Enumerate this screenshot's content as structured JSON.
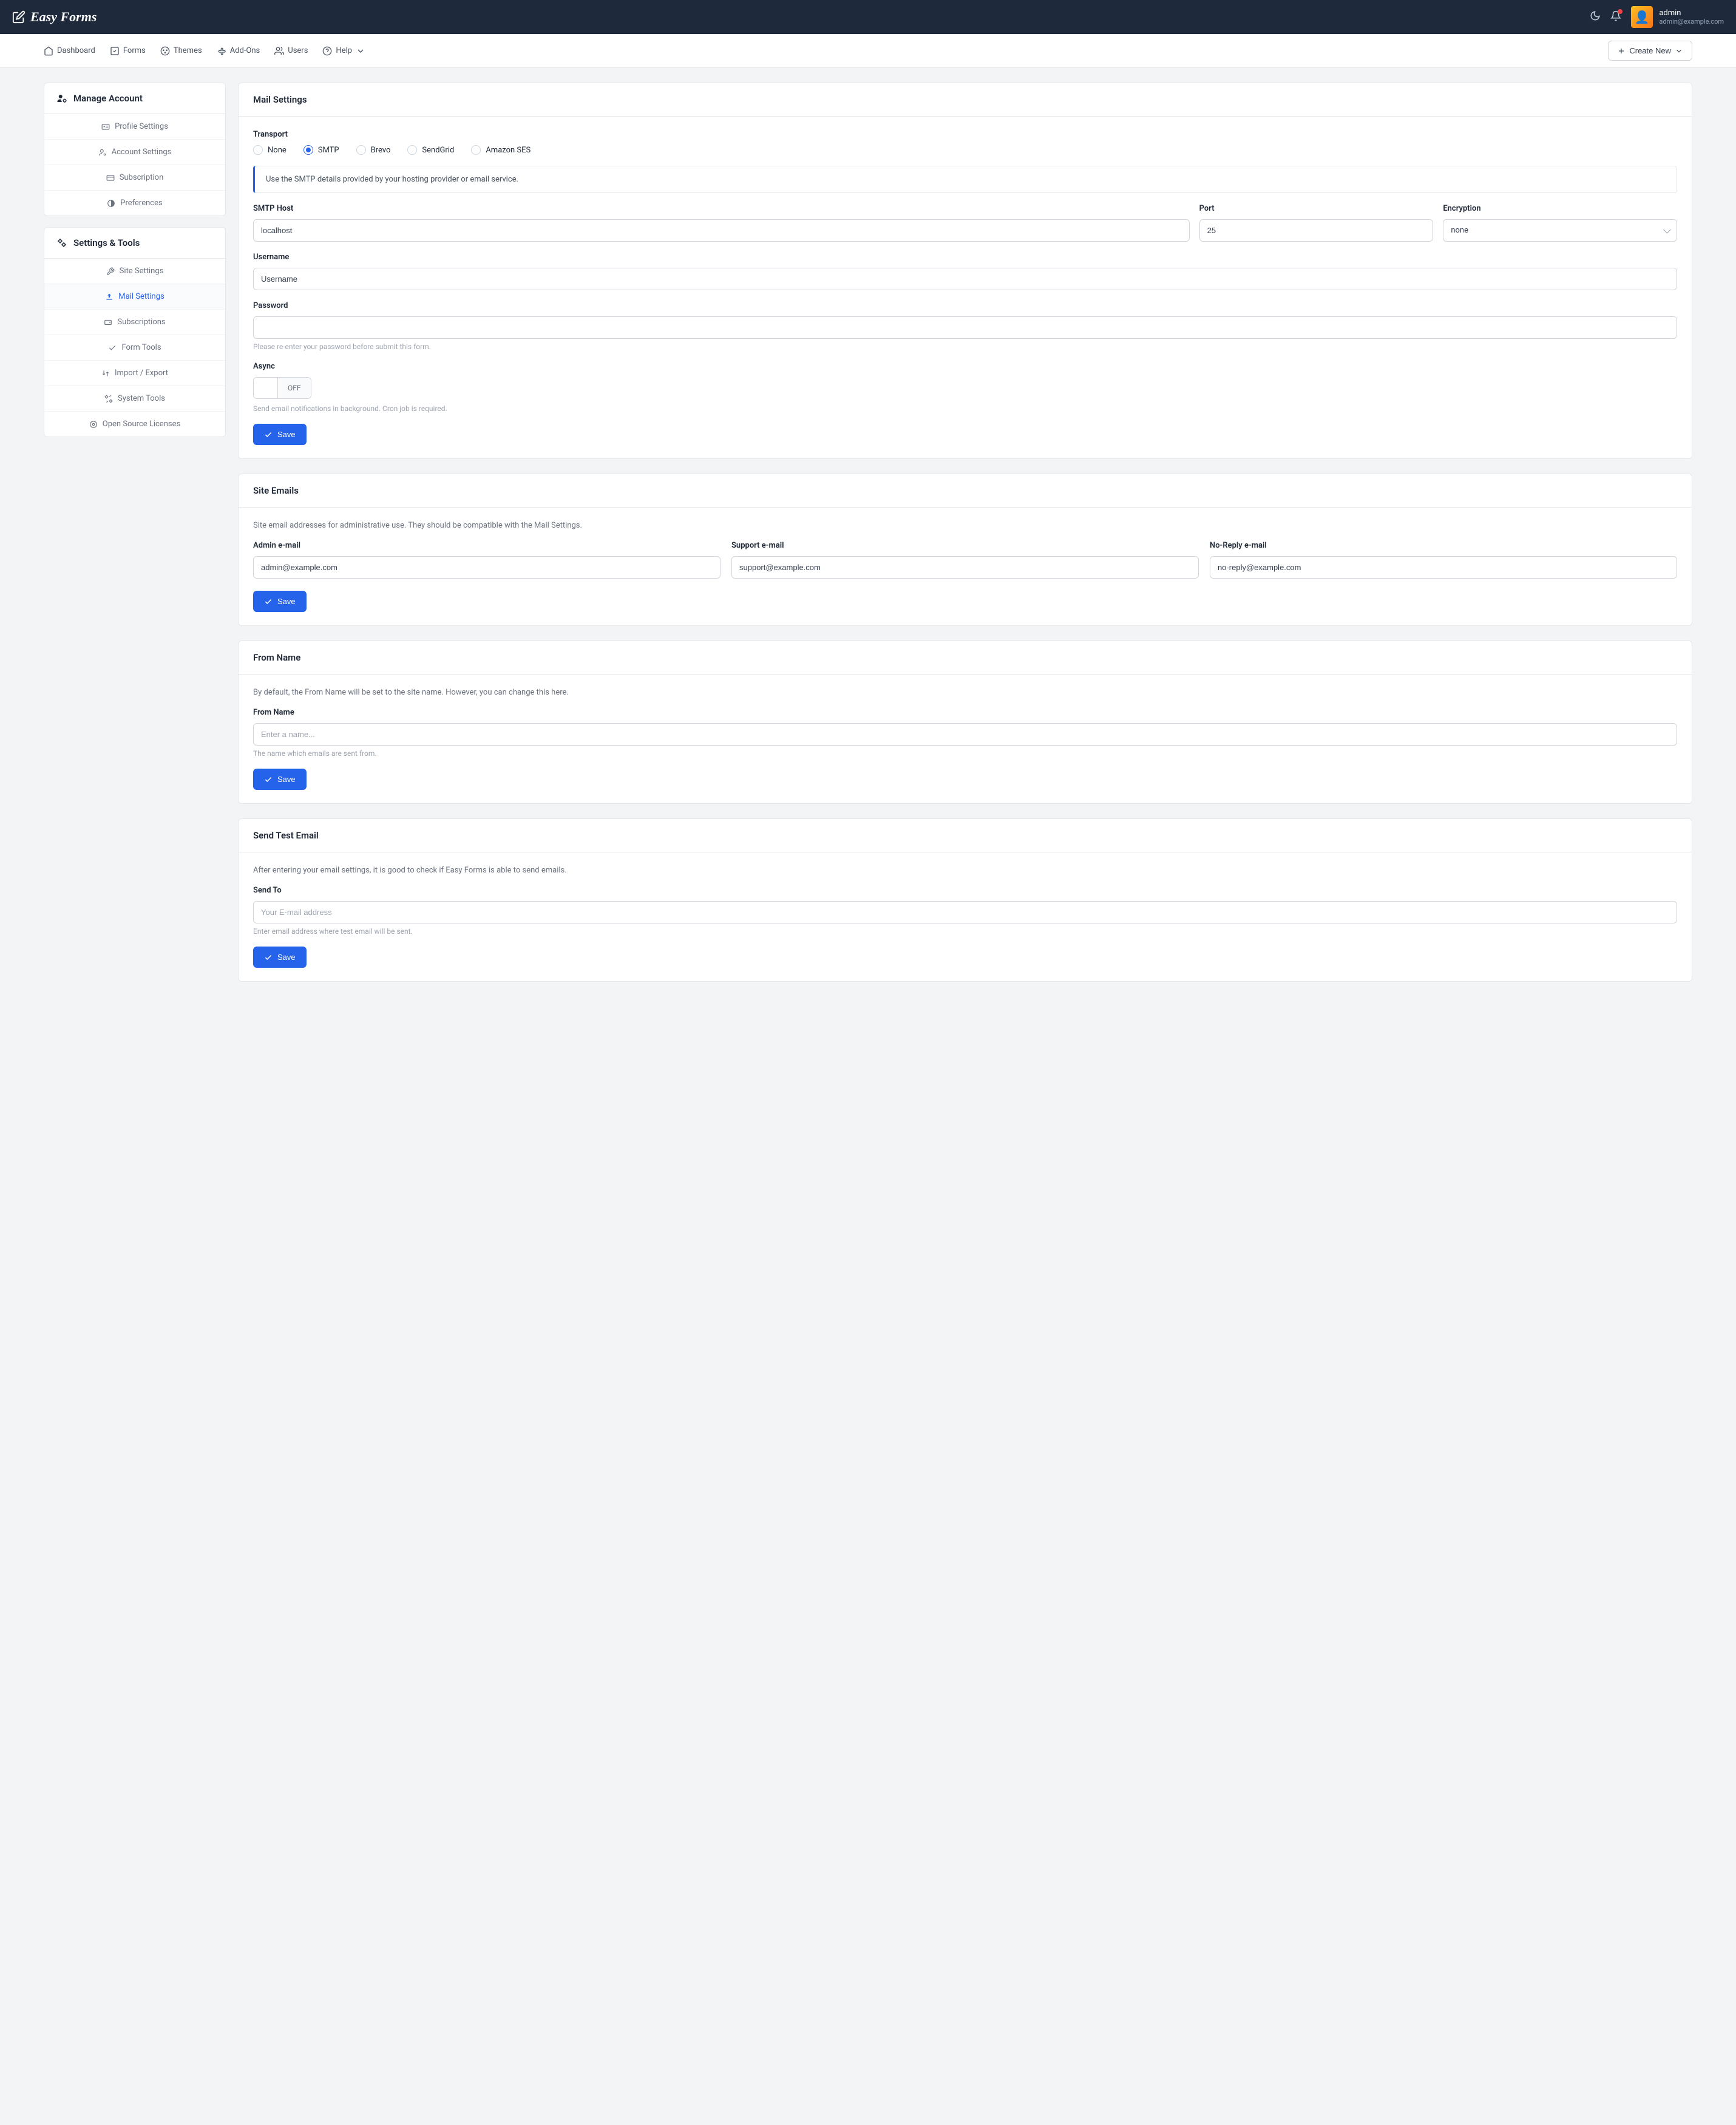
{
  "brand": "Easy Forms",
  "user": {
    "name": "admin",
    "email": "admin@example.com"
  },
  "topnav": {
    "dashboard": "Dashboard",
    "forms": "Forms",
    "themes": "Themes",
    "addons": "Add-Ons",
    "users": "Users",
    "help": "Help",
    "create": "Create New"
  },
  "sidebar": {
    "manage": {
      "title": "Manage Account",
      "profile": "Profile Settings",
      "account": "Account Settings",
      "subscription": "Subscription",
      "preferences": "Preferences"
    },
    "tools": {
      "title": "Settings & Tools",
      "site": "Site Settings",
      "mail": "Mail Settings",
      "subs": "Subscriptions",
      "ftools": "Form Tools",
      "import": "Import / Export",
      "system": "System Tools",
      "licenses": "Open Source Licenses"
    }
  },
  "mail": {
    "title": "Mail Settings",
    "transport_label": "Transport",
    "transports": {
      "none": "None",
      "smtp": "SMTP",
      "brevo": "Brevo",
      "sendgrid": "SendGrid",
      "ses": "Amazon SES"
    },
    "info": "Use the SMTP details provided by your hosting provider or email service.",
    "host_label": "SMTP Host",
    "host_value": "localhost",
    "port_label": "Port",
    "port_value": "25",
    "enc_label": "Encryption",
    "enc_value": "none",
    "user_label": "Username",
    "user_value": "Username",
    "pass_label": "Password",
    "pass_hint": "Please re-enter your password before submit this form.",
    "async_label": "Async",
    "async_value": "OFF",
    "async_hint": "Send email notifications in background. Cron job is required.",
    "save": "Save"
  },
  "emails": {
    "title": "Site Emails",
    "desc": "Site email addresses for administrative use. They should be compatible with the Mail Settings.",
    "admin_label": "Admin e-mail",
    "admin_value": "admin@example.com",
    "support_label": "Support e-mail",
    "support_value": "support@example.com",
    "noreply_label": "No-Reply e-mail",
    "noreply_value": "no-reply@example.com",
    "save": "Save"
  },
  "fromname": {
    "title": "From Name",
    "desc": "By default, the From Name will be set to the site name. However, you can change this here.",
    "label": "From Name",
    "placeholder": "Enter a name...",
    "hint": "The name which emails are sent from.",
    "save": "Save"
  },
  "test": {
    "title": "Send Test Email",
    "desc": "After entering your email settings, it is good to check if Easy Forms is able to send emails.",
    "label": "Send To",
    "placeholder": "Your E-mail address",
    "hint": "Enter email address where test email will be sent.",
    "save": "Save"
  }
}
